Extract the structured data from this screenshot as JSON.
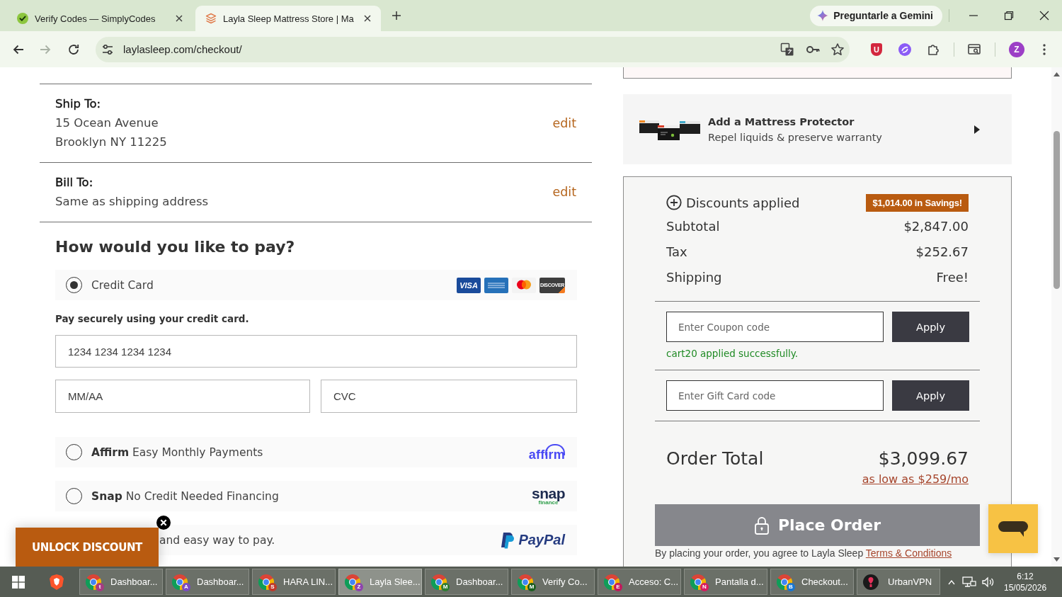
{
  "browser": {
    "tabs": [
      {
        "kind": "simplycodes",
        "title": "Verify Codes — SimplyCodes",
        "selected": false
      },
      {
        "kind": "layla",
        "title": "Layla Sleep Mattress Store | Ma",
        "selected": true
      }
    ],
    "gemini_button": "Preguntarle a Gemini",
    "forward_disabled": true,
    "url": "laylasleep.com/checkout/",
    "extension_badge": "U",
    "profile_initial": "Z"
  },
  "addresses": [
    {
      "label": "Ship To:",
      "lines": [
        "15 Ocean Avenue",
        "Brooklyn NY 11225"
      ],
      "action": "edit"
    },
    {
      "label": "Bill To:",
      "lines": [
        "Same as shipping address"
      ],
      "action": "edit"
    }
  ],
  "payment": {
    "heading": "How would you like to pay?",
    "options": [
      {
        "kind": "card",
        "label": "Credit Card",
        "selected": true,
        "brands": [
          {
            "kind": "visa",
            "text": "VISA"
          },
          {
            "kind": "amex"
          },
          {
            "kind": "mastercard"
          },
          {
            "kind": "discover",
            "text": "DISCOVER"
          }
        ]
      },
      {
        "kind": "affirm",
        "label": "**Affirm** Easy Monthly Payments",
        "selected": false,
        "logo": "affirm"
      },
      {
        "kind": "snap",
        "label": "**Snap** No Credit Needed Financing",
        "selected": false,
        "logo": "snap",
        "logo_tagline": "finance"
      }
    ],
    "card_form": {
      "note": "Pay securely using your credit card.",
      "number": {
        "placeholder": "1234 1234 1234 1234"
      },
      "expiry": {
        "placeholder": "MM/AA"
      },
      "cvc": {
        "placeholder": "CVC"
      }
    },
    "covered_option": {
      "text": "and easy way to pay.",
      "logo": "PayPal"
    }
  },
  "unlock_popup": {
    "label": "UNLOCK DISCOUNT"
  },
  "upsell": {
    "title": "Add a Mattress Protector",
    "subtitle": "Repel liquids & preserve warranty"
  },
  "summary": {
    "discounts_label": "Discounts applied",
    "savings_badge": "$1,014.00 in Savings!",
    "lines": [
      {
        "label": "Subtotal",
        "value": "$2,847.00"
      },
      {
        "label": "Tax",
        "value": "$252.67"
      },
      {
        "label": "Shipping",
        "value": "Free!"
      }
    ],
    "coupon": {
      "placeholder": "Enter Coupon code",
      "button": "Apply",
      "message": "cart20 applied successfully."
    },
    "gift_card": {
      "placeholder": "Enter Gift Card code",
      "button": "Apply"
    },
    "total_label": "Order Total",
    "total_value": "$3,099.67",
    "financing_link": "as low as $259/mo",
    "place_order": {
      "label": "Place Order",
      "disabled": true
    },
    "legal": {
      "text": "By placing your order, you agree to Layla Sleep",
      "link": "Terms & Conditions"
    }
  },
  "taskbar": {
    "items": [
      {
        "kind": "browser",
        "label": "Dashboar...",
        "profile": "t",
        "color": "#a63c82",
        "selected": false
      },
      {
        "kind": "browser",
        "label": "Dashboar...",
        "profile": "A",
        "color": "#7b4bc4",
        "selected": false
      },
      {
        "kind": "browser",
        "label": "HARA LIN...",
        "profile": "S",
        "color": "#c0392b",
        "selected": false
      },
      {
        "kind": "browser",
        "label": "Layla Slee...",
        "profile": "Z",
        "color": "#8e44ad",
        "selected": true
      },
      {
        "kind": "browser",
        "label": "Dashboar...",
        "profile": "M",
        "color": "#2e7d32",
        "selected": false
      },
      {
        "kind": "browser",
        "label": "Verify Co...",
        "profile": "M",
        "color": "#1b5e20",
        "selected": false
      },
      {
        "kind": "browser",
        "label": "Acceso: C...",
        "profile": "E",
        "color": "#c2185b",
        "selected": false
      },
      {
        "kind": "browser",
        "label": "Pantalla d...",
        "profile": "N",
        "color": "#d81b60",
        "selected": false
      },
      {
        "kind": "browser",
        "label": "Checkout...",
        "profile": "B",
        "color": "#1976d2",
        "selected": false
      },
      {
        "kind": "vpn",
        "label": "UrbanVPN",
        "selected": false
      }
    ],
    "time": "6:12",
    "date": "15/05/2026"
  }
}
